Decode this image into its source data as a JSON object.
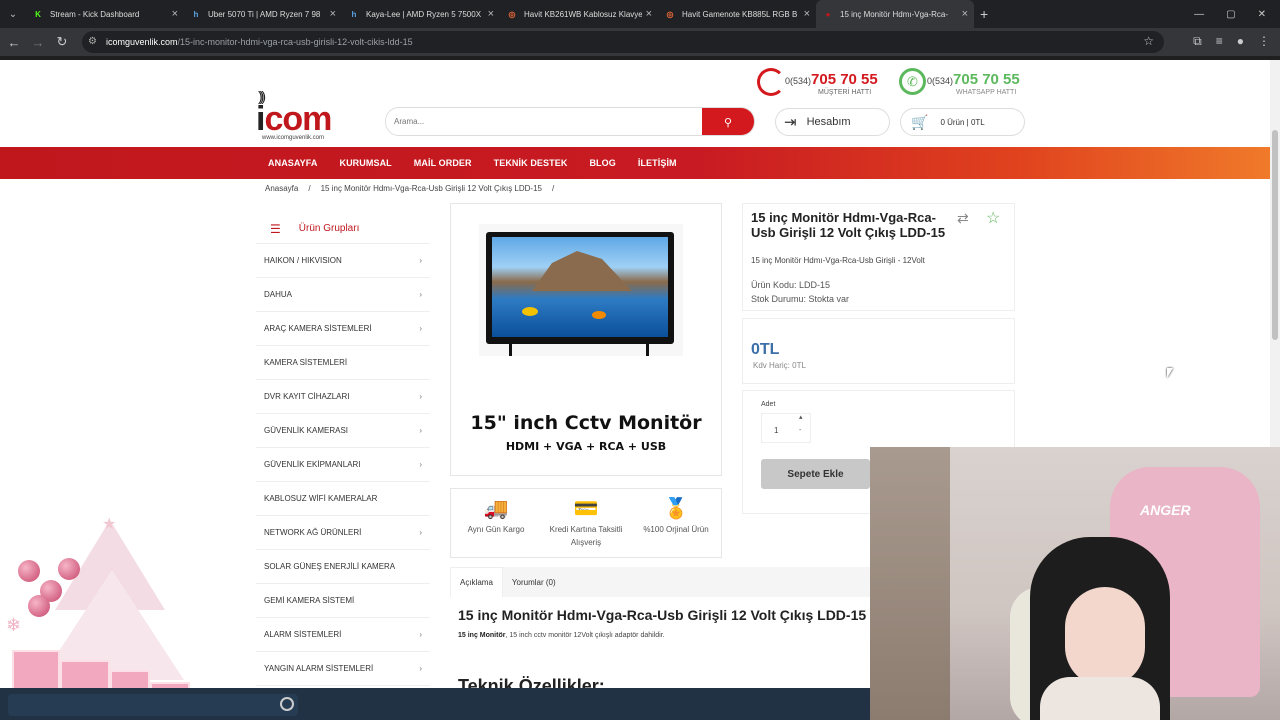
{
  "browser": {
    "tabs": [
      {
        "title": "Stream - Kick Dashboard",
        "icon": "K",
        "icon_color": "#53fc18",
        "icon_bg": "#202124"
      },
      {
        "title": "Uber 5070 Ti | AMD Ryzen 7 98",
        "icon": "h",
        "icon_color": "#5aa0e0",
        "icon_bg": "#202124"
      },
      {
        "title": "Kaya-Lee | AMD Ryzen 5 7500X",
        "icon": "h",
        "icon_color": "#5aa0e0",
        "icon_bg": "#202124"
      },
      {
        "title": "Havit KB261WB Kablosuz Klavye",
        "icon": "◎",
        "icon_color": "#f26b3a",
        "icon_bg": "#202124"
      },
      {
        "title": "Havit Gamenote KB885L RGB B",
        "icon": "◎",
        "icon_color": "#f26b3a",
        "icon_bg": "#202124"
      },
      {
        "title": "15 inç Monitör Hdmı-Vga-Rca-",
        "icon": "●",
        "icon_color": "#c0171d",
        "icon_bg": "#35363a"
      }
    ],
    "url_host": "icomguvenlik.com",
    "url_path": "/15-inc-monitor-hdmi-vga-rca-usb-girisli-12-volt-cikis-ldd-15"
  },
  "header": {
    "logo_waves": ")))",
    "logo_text_i": "i",
    "logo_text_rest": "com",
    "logo_site": "www.icomguvenlik.com",
    "search_placeholder": "Arama...",
    "hotline_prefix": "0(534)",
    "hotline_number": "705 70 55",
    "hotline_label": "MÜŞTERİ HATTI",
    "whatsapp_prefix": "0(534)",
    "whatsapp_number": "705 70 55",
    "whatsapp_label": "WHATSAPP HATTI",
    "account_label": "Hesabım",
    "cart_label": "0 Ürün | 0TL"
  },
  "menu": [
    "ANASAYFA",
    "KURUMSAL",
    "MAİL ORDER",
    "TEKNİK DESTEK",
    "BLOG",
    "İLETİŞİM"
  ],
  "breadcrumb": [
    "Anasayfa",
    "/",
    "15 inç Monitör Hdmı-Vga-Rca-Usb Girişli 12 Volt Çıkış LDD-15",
    "/"
  ],
  "sidebar": {
    "title": "Ürün Grupları",
    "items": [
      {
        "label": "HAIKON / HIKVISION",
        "chev": "›"
      },
      {
        "label": "DAHUA",
        "chev": "›"
      },
      {
        "label": "ARAÇ KAMERA SİSTEMLERİ",
        "chev": "›"
      },
      {
        "label": "KAMERA SİSTEMLERİ",
        "chev": ""
      },
      {
        "label": "DVR KAYIT CİHAZLARI",
        "chev": "›"
      },
      {
        "label": "GÜVENLİK KAMERASI",
        "chev": "›"
      },
      {
        "label": "GÜVENLİK EKİPMANLARI",
        "chev": "›"
      },
      {
        "label": "KABLOSUZ WİFİ KAMERALAR",
        "chev": ""
      },
      {
        "label": "NETWORK AĞ ÜRÜNLERİ",
        "chev": "›"
      },
      {
        "label": "SOLAR GÜNEŞ ENERJİLİ KAMERA",
        "chev": ""
      },
      {
        "label": "GEMİ KAMERA SİSTEMİ",
        "chev": ""
      },
      {
        "label": "ALARM SİSTEMLERİ",
        "chev": "›"
      },
      {
        "label": "YANGIN ALARM SİSTEMLERİ",
        "chev": "›"
      }
    ]
  },
  "product_image": {
    "caption_line1": "15\" inch Cctv Monitör",
    "caption_line2": "HDMI + VGA + RCA + USB"
  },
  "features": [
    {
      "icon": "truck-icon",
      "glyph": "🚚",
      "label": "Aynı Gün Kargo"
    },
    {
      "icon": "credit-card-icon",
      "glyph": "💳",
      "label": "Kredi Kartına Taksitli Alışveriş"
    },
    {
      "icon": "badge-icon",
      "glyph": "🏅",
      "label": "%100 Orjinal Ürün"
    }
  ],
  "product": {
    "title": "15 inç Monitör Hdmı-Vga-Rca-Usb Girişli 12 Volt Çıkış LDD-15",
    "subtitle": "15 inç Monitör Hdmı-Vga-Rca-Usb Girişli - 12Volt",
    "code": "Ürün Kodu: LDD-15",
    "stock": "Stok Durumu: Stokta var",
    "price": "0TL",
    "price_ex": "Kdv Hariç: 0TL",
    "qty_label": "Adet",
    "qty_value": "1",
    "add_to_cart": "Sepete Ekle"
  },
  "tabs": [
    "Açıklama",
    "Yorumlar (0)"
  ],
  "description": {
    "heading": "15 inç Monitör Hdmı-Vga-Rca-Usb Girişli 12 Volt Çıkış LDD-15",
    "line_bold": "15 inç Monitör",
    "line_rest": ", 15 inch cctv monitör 12Volt çıkışlı adaptör dahildir.",
    "tech_heading": "Teknik Özellikler:"
  },
  "webcam": {
    "chair_text": "ANGER"
  },
  "colors": {
    "brand_red": "#c0171d",
    "whatsapp_green": "#5cb85c",
    "price_blue": "#3a6fa8"
  }
}
